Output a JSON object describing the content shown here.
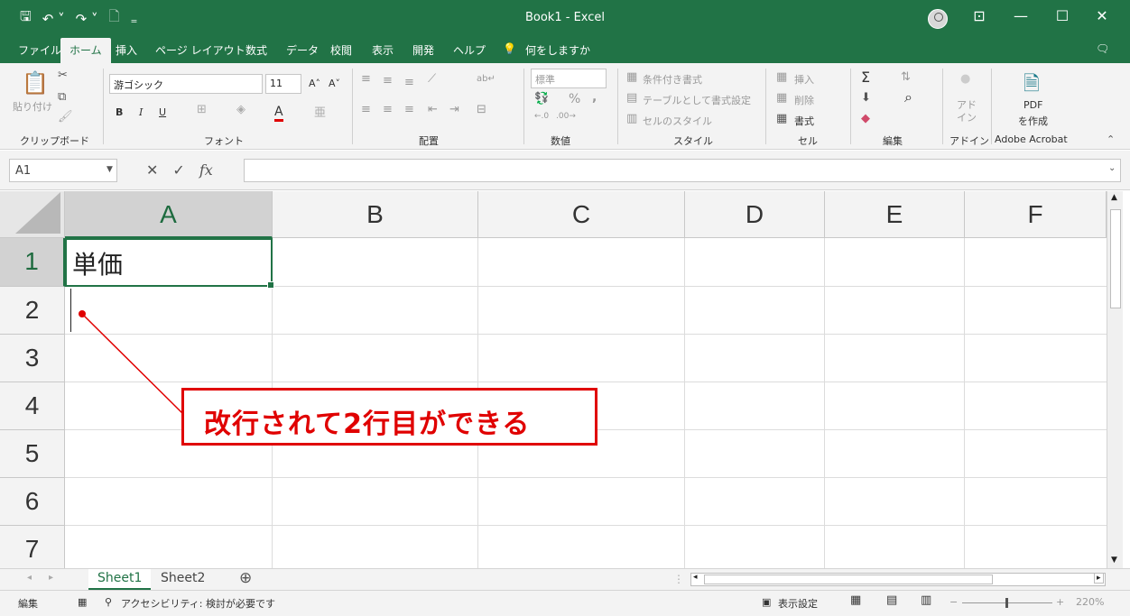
{
  "window": {
    "title": "Book1  -  Excel",
    "minimize": "—",
    "maximize": "☐",
    "close": "✕",
    "restore_icon": "⊡"
  },
  "qat": {
    "save": "🖫",
    "undo": "↶ ˅",
    "redo": "↷ ˅",
    "new": "🗋",
    "more": "₌"
  },
  "tabs": [
    "ファイル",
    "ホーム",
    "挿入",
    "ページ レイアウト",
    "数式",
    "データ",
    "校閲",
    "表示",
    "開発",
    "ヘルプ"
  ],
  "active_tab": "ホーム",
  "tell_me": "何をしますか",
  "ribbon": {
    "clipboard": {
      "paste": "貼り付け",
      "label": "クリップボード"
    },
    "font": {
      "name": "游ゴシック",
      "size": "11",
      "grow": "A˄",
      "shrink": "A˅",
      "bold": "B",
      "italic": "I",
      "underline": "U",
      "color_a": "A",
      "label": "フォント"
    },
    "alignment": {
      "label": "配置"
    },
    "number": {
      "format": "標準",
      "percent": "%",
      "comma": ",",
      "label": "数値"
    },
    "styles": {
      "conditional": "条件付き書式",
      "table": "テーブルとして書式設定",
      "cell_styles": "セルのスタイル",
      "label": "スタイル"
    },
    "cells": {
      "insert": "挿入",
      "delete": "削除",
      "format": "書式",
      "label": "セル"
    },
    "editing": {
      "sum": "Σ",
      "find": "⌕",
      "label": "編集"
    },
    "addins": {
      "button": "アド\nイン",
      "label": "アドイン"
    },
    "acrobat": {
      "button_line1": "PDF",
      "button_line2": "を作成",
      "label": "Adobe Acrobat"
    }
  },
  "formula_bar": {
    "name_box": "A1",
    "cancel": "✕",
    "enter": "✓",
    "fx": "fx",
    "value": ""
  },
  "columns": [
    "A",
    "B",
    "C",
    "D",
    "E",
    "F"
  ],
  "rows": [
    "1",
    "2",
    "3",
    "4",
    "5",
    "6",
    "7"
  ],
  "cells": {
    "A1": "単価"
  },
  "annotation": "改行されて2行目ができる",
  "sheets": [
    "Sheet1",
    "Sheet2"
  ],
  "active_sheet": "Sheet1",
  "add_sheet": "⊕",
  "status": {
    "mode": "編集",
    "accessibility": "アクセシビリティ: 検討が必要です",
    "display_settings": "表示設定",
    "zoom": "220%"
  },
  "colors": {
    "brand": "#217346",
    "annotation": "#e00000"
  }
}
